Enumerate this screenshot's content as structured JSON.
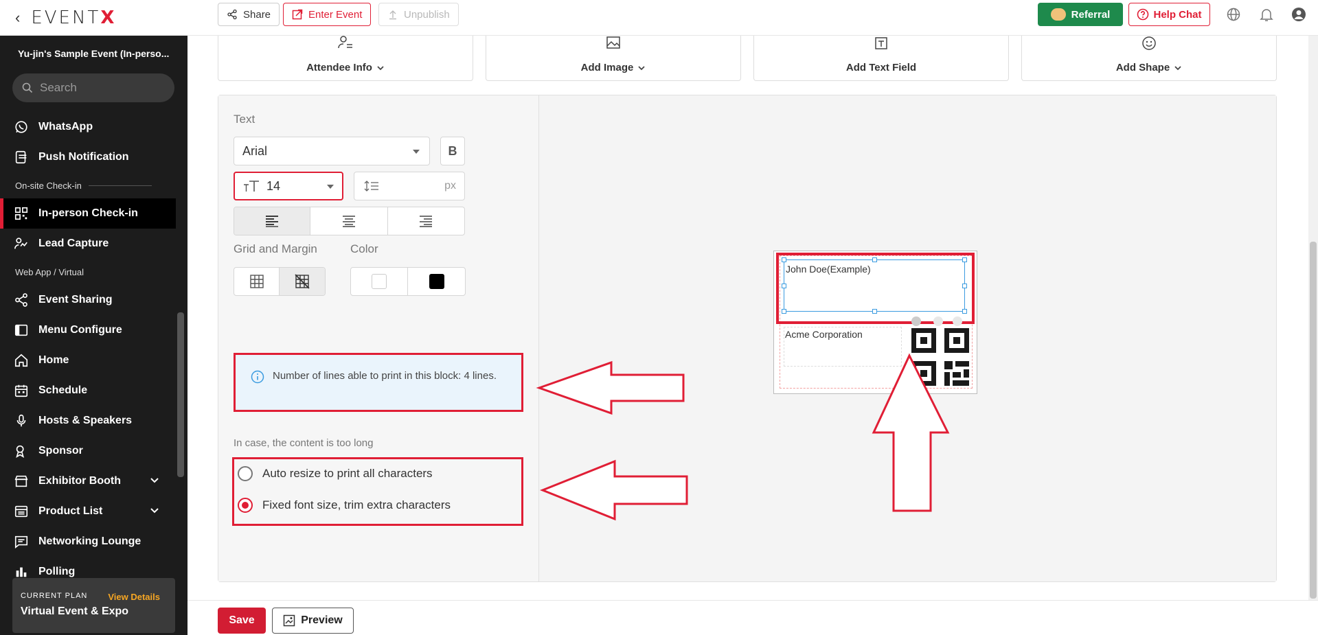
{
  "header": {
    "logo_text": "EVENT",
    "logo_accent": "X",
    "share_label": "Share",
    "enter_event_label": "Enter Event",
    "unpublish_label": "Unpublish",
    "referral_label": "Referral",
    "help_chat_label": "Help Chat",
    "icons": [
      "globe-icon",
      "bell-icon",
      "user-icon"
    ]
  },
  "sidebar": {
    "event_name": "Yu-jin's Sample Event (In-perso...",
    "search_placeholder": "Search",
    "items": [
      {
        "type": "item",
        "label": "WhatsApp",
        "icon": "whatsapp-icon"
      },
      {
        "type": "item",
        "label": "Push Notification",
        "icon": "push-notification-icon"
      },
      {
        "type": "section",
        "label": "On-site Check-in"
      },
      {
        "type": "item",
        "label": "In-person Check-in",
        "icon": "qr-code-icon",
        "active": true
      },
      {
        "type": "item",
        "label": "Lead Capture",
        "icon": "lead-capture-icon"
      },
      {
        "type": "section",
        "label": "Web App / Virtual"
      },
      {
        "type": "item",
        "label": "Event Sharing",
        "icon": "share-icon"
      },
      {
        "type": "item",
        "label": "Menu Configure",
        "icon": "menu-configure-icon"
      },
      {
        "type": "item",
        "label": "Home",
        "icon": "home-icon"
      },
      {
        "type": "item",
        "label": "Schedule",
        "icon": "calendar-icon"
      },
      {
        "type": "item",
        "label": "Hosts & Speakers",
        "icon": "microphone-icon"
      },
      {
        "type": "item",
        "label": "Sponsor",
        "icon": "sponsor-icon"
      },
      {
        "type": "item",
        "label": "Exhibitor Booth",
        "icon": "booth-icon",
        "expandable": true
      },
      {
        "type": "item",
        "label": "Product List",
        "icon": "product-list-icon",
        "expandable": true
      },
      {
        "type": "item",
        "label": "Networking Lounge",
        "icon": "chat-icon"
      },
      {
        "type": "item",
        "label": "Polling",
        "icon": "polling-icon"
      }
    ],
    "plan": {
      "label": "CURRENT PLAN",
      "link": "View Details",
      "name": "Virtual Event & Expo"
    }
  },
  "toolbar": {
    "tools": [
      {
        "label": "Attendee Info",
        "icon": "attendee-info-icon",
        "dropdown": true
      },
      {
        "label": "Add Image",
        "icon": "image-icon",
        "dropdown": true
      },
      {
        "label": "Add Text Field",
        "icon": "text-field-icon",
        "dropdown": false
      },
      {
        "label": "Add Shape",
        "icon": "shape-icon",
        "dropdown": true
      }
    ]
  },
  "properties": {
    "section_label": "Text",
    "font_family": "Arial",
    "bold_label": "B",
    "font_size": "14",
    "line_height_unit": "px",
    "align_options": [
      "left",
      "center",
      "right"
    ],
    "align_selected": "left",
    "grid_margin_label": "Grid and Margin",
    "color_label": "Color",
    "colors": [
      "#ffffff",
      "#000000"
    ],
    "info_text": "Number of lines able to print in this block: 4 lines.",
    "overflow_label": "In case, the content is too long",
    "overflow_options": [
      {
        "label": "Auto resize to print all characters",
        "selected": false
      },
      {
        "label": "Fixed font size, trim extra characters",
        "selected": true
      }
    ]
  },
  "badge": {
    "name_text": "John Doe(Example)",
    "company_text": "Acme Corporation"
  },
  "footer": {
    "save_label": "Save",
    "preview_label": "Preview"
  },
  "colors": {
    "brand_red": "#e01e35",
    "sidebar_bg": "#1c1c1c",
    "referral_green": "#1e8a4c",
    "plan_link": "#f6a623",
    "selection_blue": "#3a9be0"
  }
}
